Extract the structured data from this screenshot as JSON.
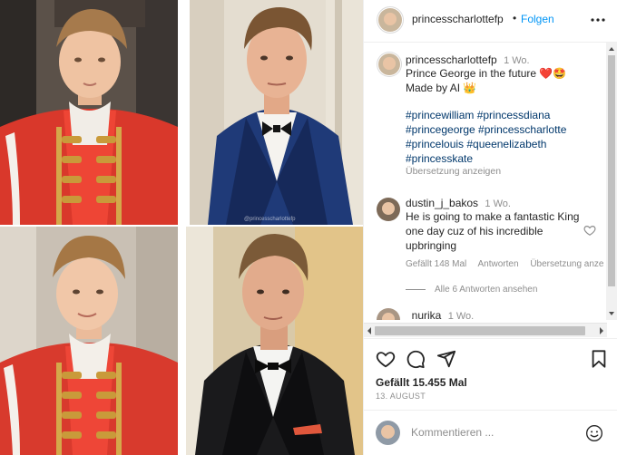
{
  "post": {
    "username": "princesscharlottefp",
    "separator": "•",
    "follow_label": "Folgen",
    "watermark": "@princesscharlottefp"
  },
  "caption": {
    "username": "princesscharlottefp",
    "age": "1 Wo.",
    "line1": "Prince George in the future ❤️🤩",
    "line2": "Made by AI 👑",
    "hashtags": "#princewilliam #princessdiana #princegeorge #princesscharlotte #princelouis #queenelizabeth #princesskate",
    "translate_label": "Übersetzung anzeigen"
  },
  "comments": [
    {
      "username": "dustin_j_bakos",
      "age": "1 Wo.",
      "text": "He is going to make a fantastic King one day cuz of his incredible upbringing",
      "likes_label": "Gefällt 148 Mal",
      "reply_label": "Antworten",
      "translate_label": "Übersetzung anze",
      "view_replies_label": "Alle 6 Antworten ansehen"
    },
    {
      "username": "_nurika",
      "age": "1 Wo."
    }
  ],
  "stats": {
    "likes": "Gefällt 15.455 Mal",
    "date": "13. AUGUST"
  },
  "comment_input": {
    "placeholder": "Kommentieren ..."
  },
  "icons": {
    "more": "more-horizontal-icon",
    "like": "heart-icon",
    "comment": "comment-icon",
    "share": "send-icon",
    "save": "bookmark-icon",
    "emoji": "emoji-icon"
  },
  "colors": {
    "link": "#0095f6",
    "hashtag": "#00376b",
    "muted": "#8e8e8e",
    "text": "#262626"
  }
}
